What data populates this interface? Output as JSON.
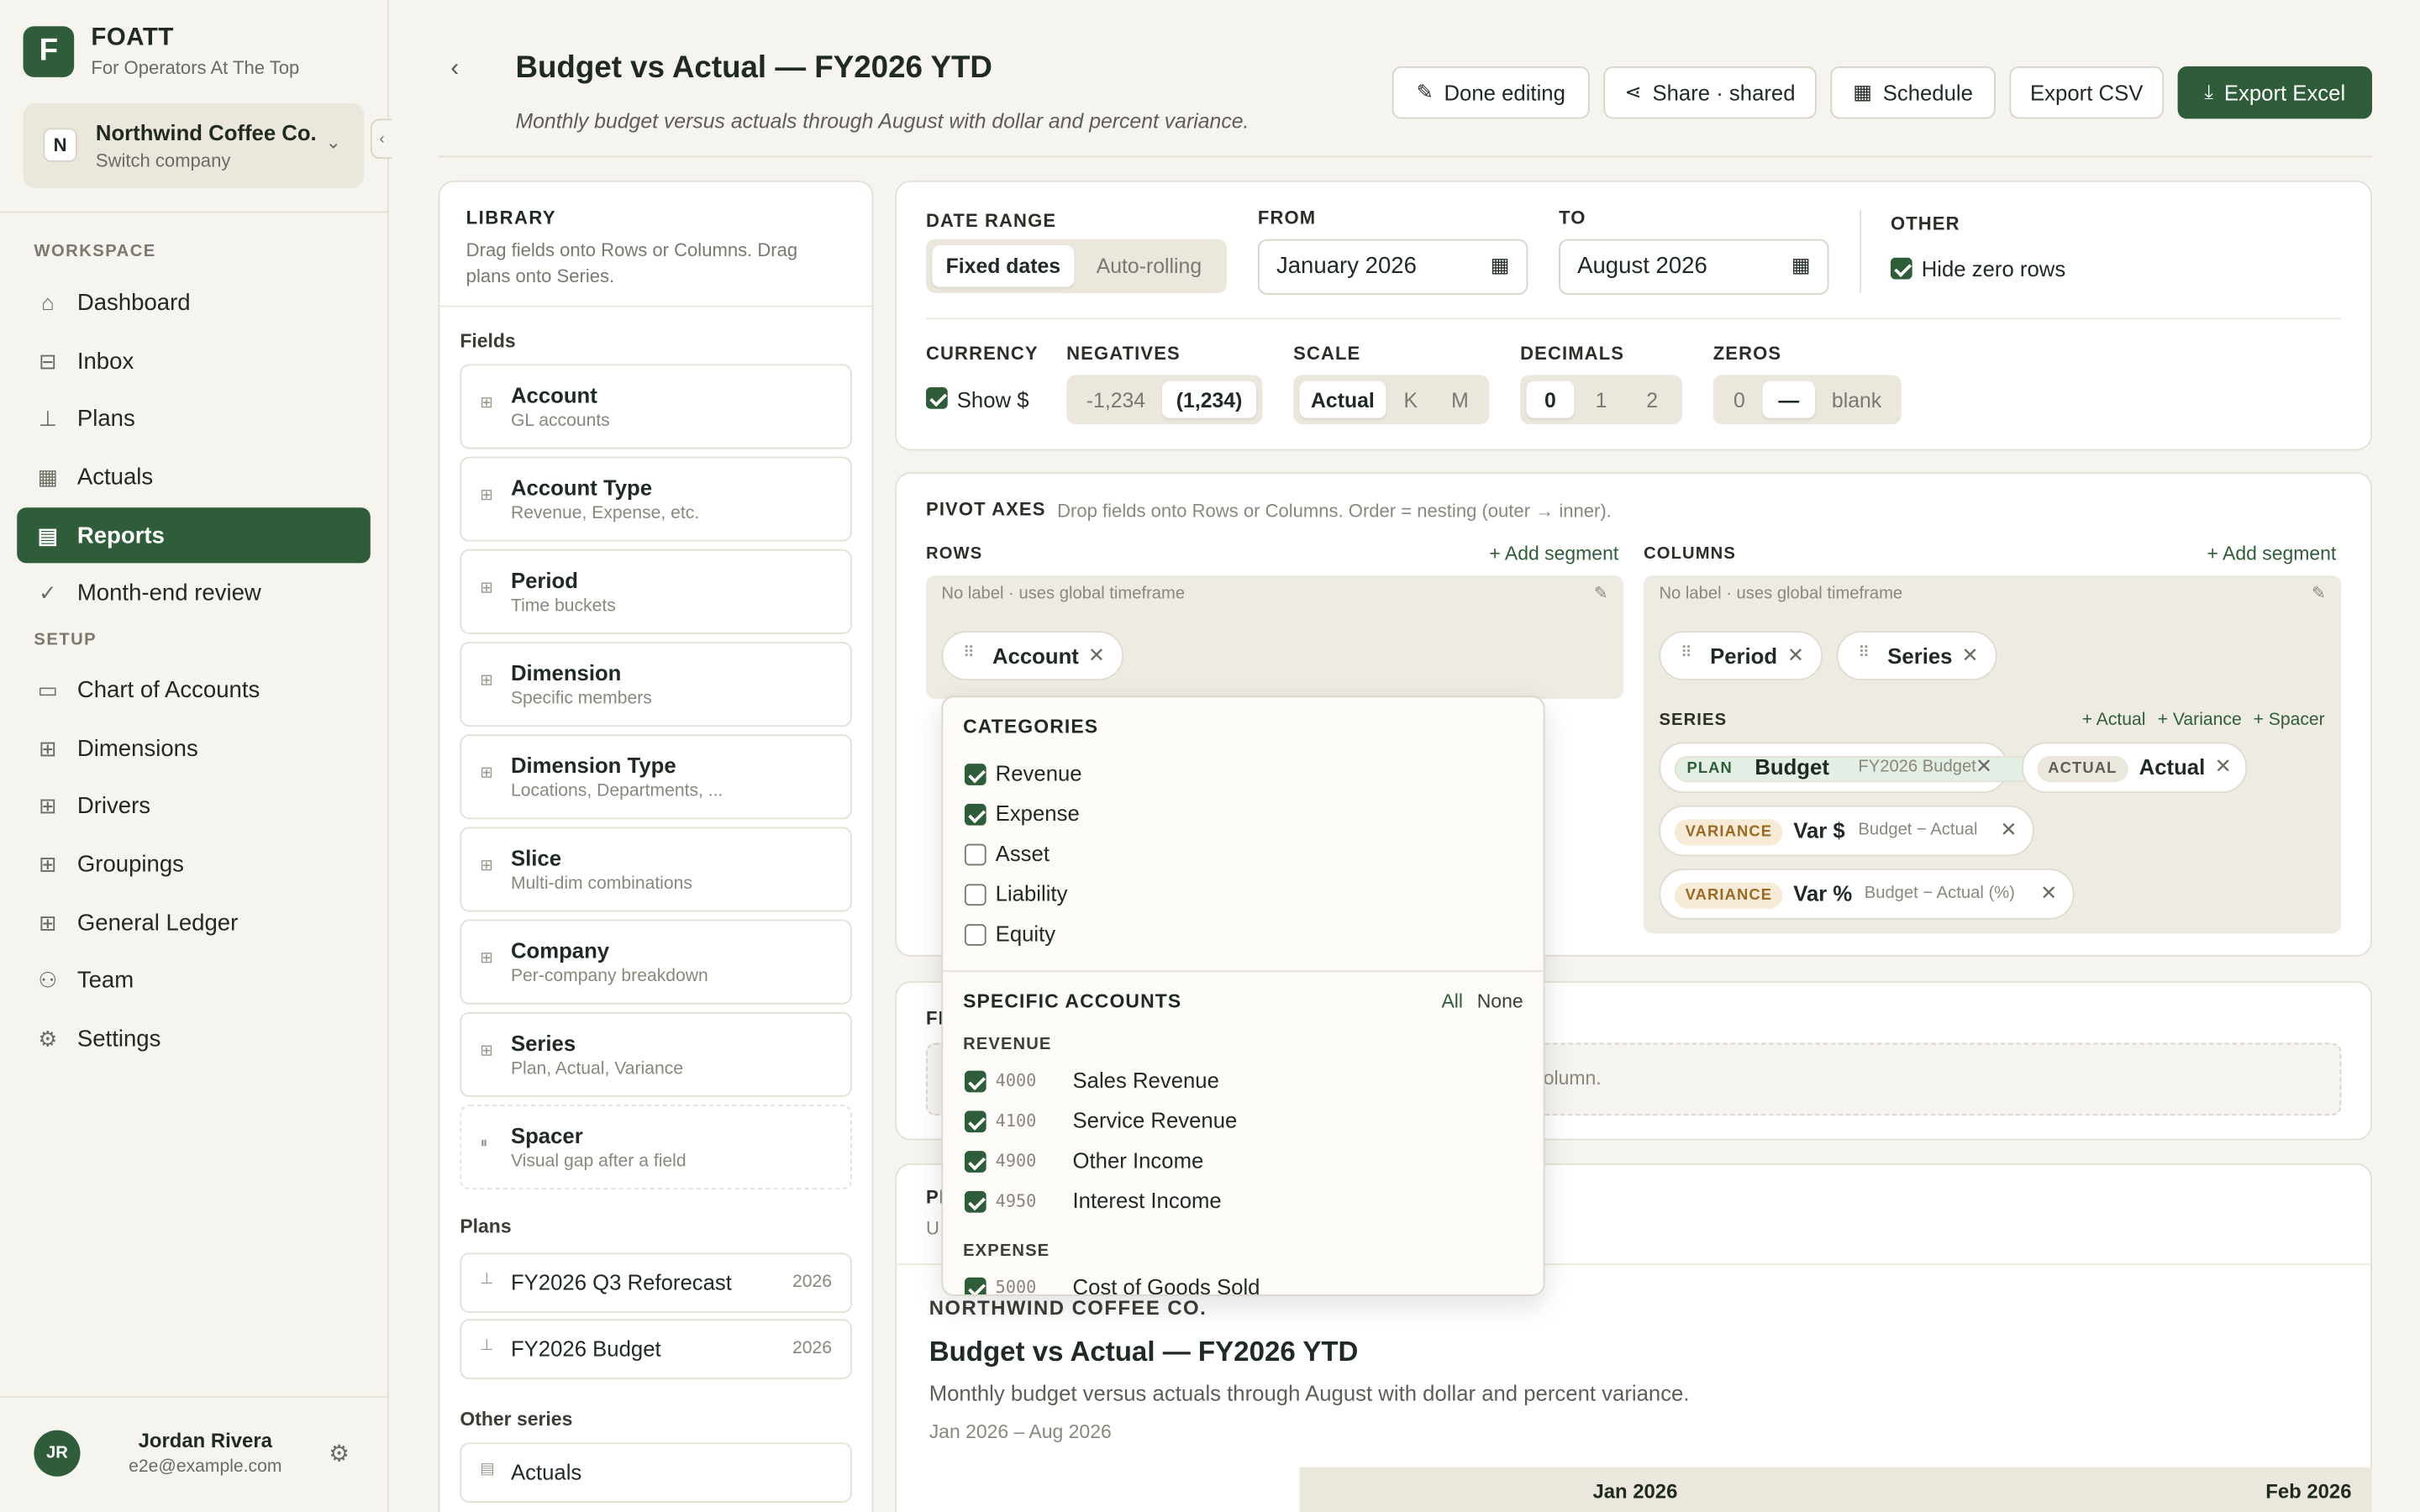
{
  "app": {
    "logo_letter": "F",
    "name": "FOATT",
    "tagline": "For Operators At The Top"
  },
  "company": {
    "initial": "N",
    "name": "Northwind Coffee Co.",
    "switch": "Switch company"
  },
  "nav": {
    "workspace_label": "WORKSPACE",
    "setup_label": "SETUP",
    "workspace": [
      {
        "label": "Dashboard",
        "icon": "home-icon"
      },
      {
        "label": "Inbox",
        "icon": "inbox-icon"
      },
      {
        "label": "Plans",
        "icon": "bar-chart-icon"
      },
      {
        "label": "Actuals",
        "icon": "table-icon"
      },
      {
        "label": "Reports",
        "icon": "report-icon",
        "active": true
      },
      {
        "label": "Month-end review",
        "icon": "check-icon"
      }
    ],
    "setup": [
      {
        "label": "Chart of Accounts",
        "icon": "ledger-icon"
      },
      {
        "label": "Dimensions",
        "icon": "grid-icon"
      },
      {
        "label": "Drivers",
        "icon": "grid-icon"
      },
      {
        "label": "Groupings",
        "icon": "grid-icon"
      },
      {
        "label": "General Ledger",
        "icon": "grid-icon"
      },
      {
        "label": "Team",
        "icon": "users-icon"
      },
      {
        "label": "Settings",
        "icon": "gear-icon"
      }
    ]
  },
  "user": {
    "initials": "JR",
    "name": "Jordan Rivera",
    "email": "e2e@example.com"
  },
  "header": {
    "title": "Budget vs Actual — FY2026 YTD",
    "subtitle": "Monthly budget versus actuals through August with dollar and percent variance.",
    "buttons": {
      "done": "Done editing",
      "share": "Share · shared",
      "schedule": "Schedule",
      "csv": "Export CSV",
      "excel": "Export Excel"
    }
  },
  "library": {
    "heading": "LIBRARY",
    "description": "Drag fields onto Rows or Columns. Drag plans onto Series.",
    "fields_label": "Fields",
    "fields": [
      {
        "name": "Account",
        "desc": "GL accounts"
      },
      {
        "name": "Account Type",
        "desc": "Revenue, Expense, etc."
      },
      {
        "name": "Period",
        "desc": "Time buckets"
      },
      {
        "name": "Dimension",
        "desc": "Specific members"
      },
      {
        "name": "Dimension Type",
        "desc": "Locations, Departments, ..."
      },
      {
        "name": "Slice",
        "desc": "Multi-dim combinations"
      },
      {
        "name": "Company",
        "desc": "Per-company breakdown"
      },
      {
        "name": "Series",
        "desc": "Plan, Actual, Variance"
      },
      {
        "name": "Spacer",
        "desc": "Visual gap after a field"
      }
    ],
    "plans_label": "Plans",
    "plans": [
      {
        "name": "FY2026 Q3 Reforecast",
        "year": "2026"
      },
      {
        "name": "FY2026 Budget",
        "year": "2026"
      }
    ],
    "other_label": "Other series",
    "other": [
      {
        "name": "Actuals"
      }
    ]
  },
  "settings": {
    "date_range_label": "DATE RANGE",
    "fixed": "Fixed dates",
    "rolling": "Auto-rolling",
    "from_label": "FROM",
    "from_value": "January  2026",
    "to_label": "TO",
    "to_value": "August  2026",
    "other_label": "OTHER",
    "hide_zero": "Hide zero rows",
    "currency_label": "CURRENCY",
    "show_dollar": "Show $",
    "negatives_label": "NEGATIVES",
    "neg_opts": [
      "-1,234",
      "(1,234)"
    ],
    "scale_label": "SCALE",
    "scale_opts": [
      "Actual",
      "K",
      "M"
    ],
    "decimals_label": "DECIMALS",
    "dec_opts": [
      "0",
      "1",
      "2"
    ],
    "zeros_label": "ZEROS",
    "zero_opts": [
      "0",
      "—",
      "blank"
    ]
  },
  "pivot": {
    "heading": "PIVOT AXES",
    "hint": "Drop fields onto Rows or Columns. Order = nesting (outer → inner).",
    "rows_label": "ROWS",
    "columns_label": "COLUMNS",
    "add_segment": "+ Add segment",
    "no_label": "No label · uses global timeframe",
    "row_chips": [
      "Account"
    ],
    "col_chips": [
      "Period",
      "Series"
    ],
    "series_label": "SERIES",
    "add_actual": "+ Actual",
    "add_variance": "+ Variance",
    "add_spacer": "+ Spacer",
    "series": [
      {
        "tag": "PLAN",
        "name": "Budget",
        "meta": "FY2026 Budget"
      },
      {
        "tag": "ACTUAL",
        "name": "Actual",
        "meta": ""
      },
      {
        "tag": "VARIANCE",
        "name": "Var $",
        "meta": "Budget − Actual"
      },
      {
        "tag": "VARIANCE",
        "name": "Var %",
        "meta": "Budget − Actual (%)"
      }
    ]
  },
  "filters": {
    "partial_label": "FI",
    "partial_hint": "olumn."
  },
  "preview": {
    "partial_label": "Pl",
    "partial_u": "U",
    "company": "NORTHWIND COFFEE CO.",
    "title": "Budget vs Actual — FY2026 YTD",
    "subtitle": "Monthly budget versus actuals through August with dollar and percent variance.",
    "range": "Jan 2026 – Aug 2026",
    "col1": "Jan 2026",
    "col2": "Feb 2026"
  },
  "popup": {
    "categories_label": "CATEGORIES",
    "categories": [
      {
        "name": "Revenue",
        "checked": true
      },
      {
        "name": "Expense",
        "checked": true
      },
      {
        "name": "Asset",
        "checked": false
      },
      {
        "name": "Liability",
        "checked": false
      },
      {
        "name": "Equity",
        "checked": false
      }
    ],
    "specific_label": "SPECIFIC ACCOUNTS",
    "all": "All",
    "none": "None",
    "revenue_label": "REVENUE",
    "expense_label": "EXPENSE",
    "revenue": [
      {
        "code": "4000",
        "name": "Sales Revenue"
      },
      {
        "code": "4100",
        "name": "Service Revenue"
      },
      {
        "code": "4900",
        "name": "Other Income"
      },
      {
        "code": "4950",
        "name": "Interest Income"
      }
    ],
    "expense": [
      {
        "code": "5000",
        "name": "Cost of Goods Sold"
      }
    ]
  }
}
